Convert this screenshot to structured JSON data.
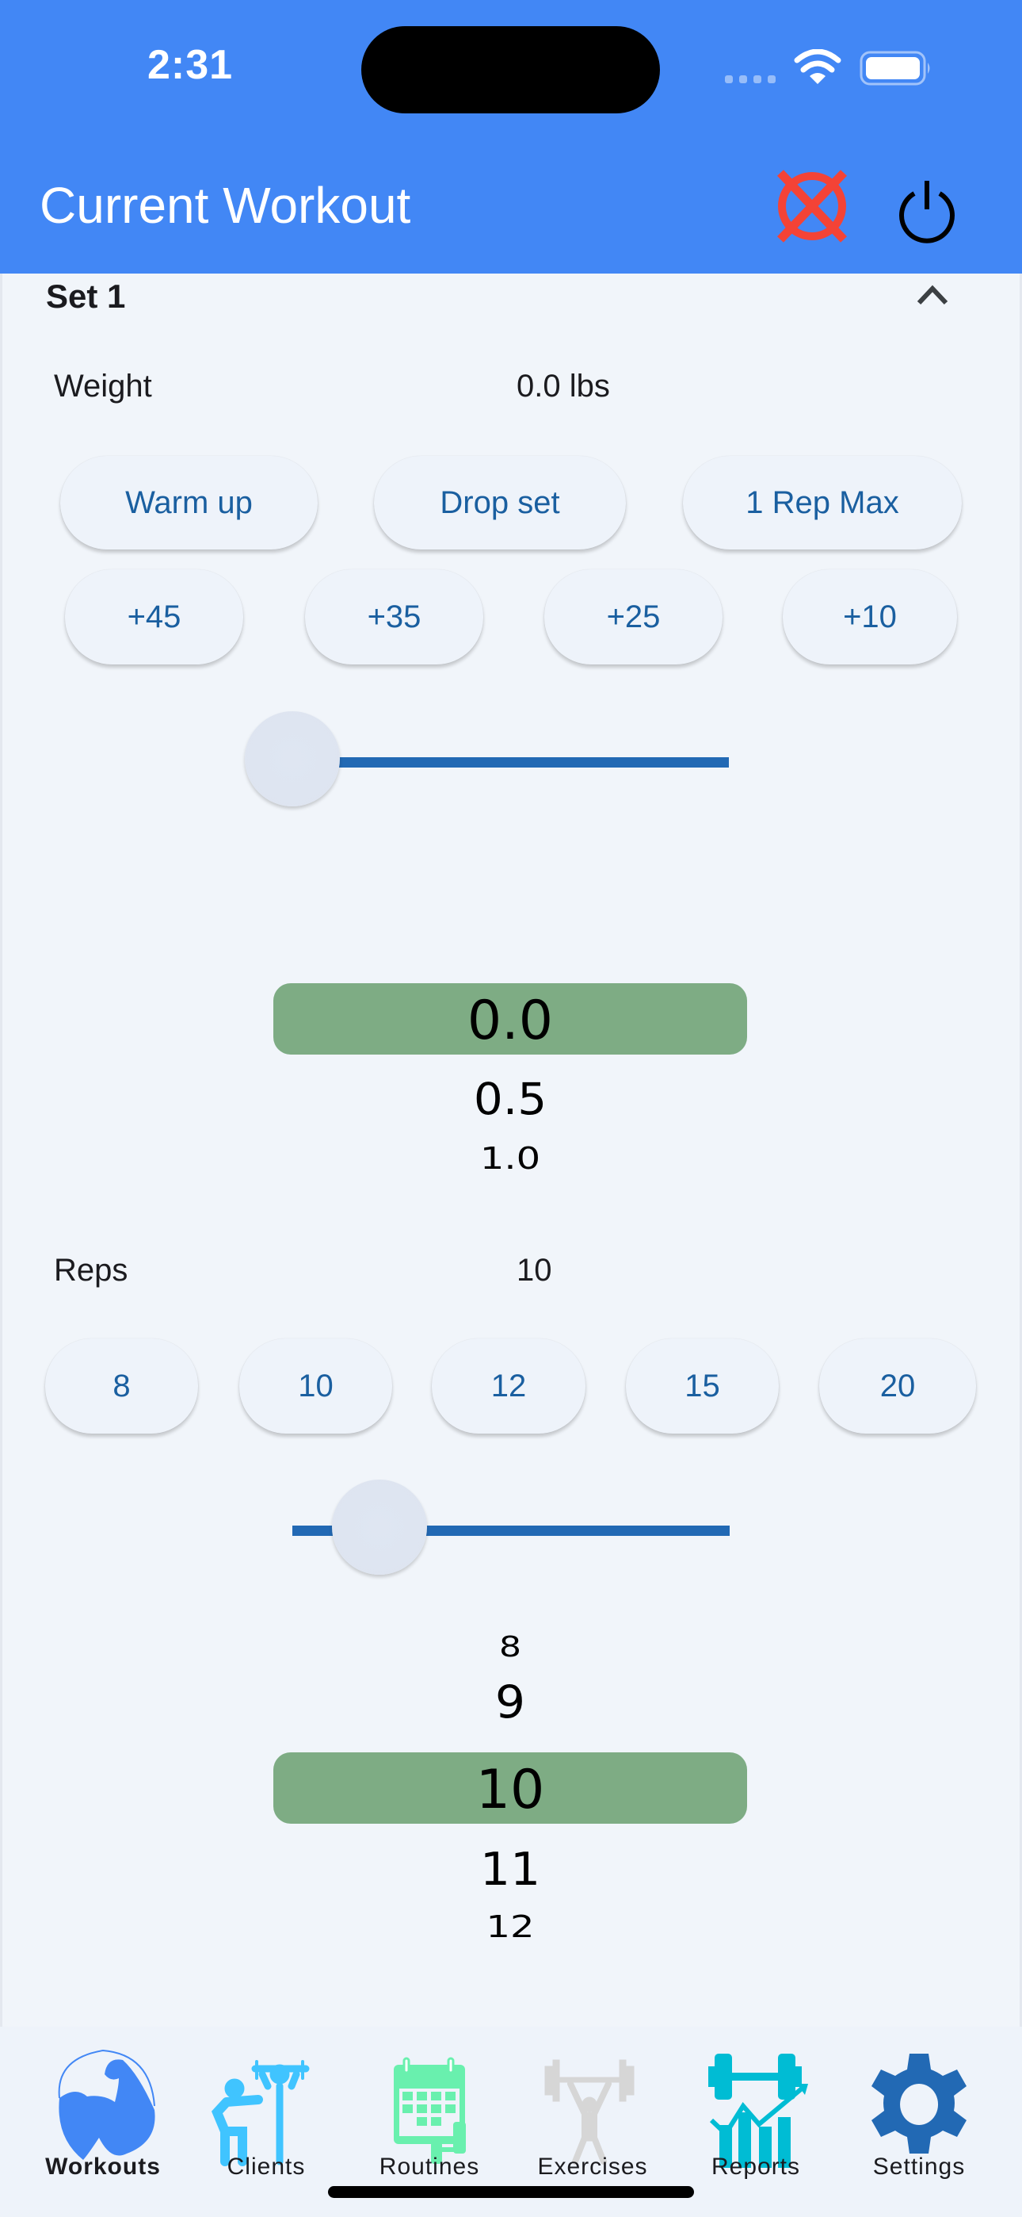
{
  "status_bar": {
    "time": "2:31"
  },
  "app_bar": {
    "title": "Current Workout",
    "actions": [
      {
        "name": "cancel-workout",
        "icon": "cancel-circle-x-icon",
        "color": "#F44336"
      },
      {
        "name": "power",
        "icon": "power-icon",
        "color": "#000000"
      }
    ]
  },
  "set": {
    "title": "Set 1",
    "expanded": true,
    "weight": {
      "label": "Weight",
      "value_display": "0.0 lbs",
      "set_type_buttons": [
        "Warm up",
        "Drop set",
        "1 Rep Max"
      ],
      "increment_buttons": [
        "+45",
        "+35",
        "+25",
        "+10"
      ],
      "slider_fraction": 0.0,
      "picker": {
        "selected": "0.0",
        "items_below": [
          "0.5",
          "1.0"
        ]
      }
    },
    "reps": {
      "label": "Reps",
      "value_display": "10",
      "quick_buttons": [
        "8",
        "10",
        "12",
        "15",
        "20"
      ],
      "slider_fraction": 0.2,
      "picker": {
        "items_above": [
          "8",
          "9"
        ],
        "selected": "10",
        "items_below": [
          "11",
          "12"
        ]
      }
    }
  },
  "colors": {
    "header": "#4287F5",
    "accent": "#2269B4",
    "button_text": "#1A5FA0",
    "picker_highlight": "#7EAC84",
    "background": "#F1F5FA"
  },
  "tabs": [
    {
      "label": "Workouts",
      "icon": "flexed-bicep-icon",
      "active": true,
      "color": "#4287F5"
    },
    {
      "label": "Clients",
      "icon": "trainer-client-icon",
      "active": false,
      "color": "#40C4FF"
    },
    {
      "label": "Routines",
      "icon": "calendar-dumbbell-icon",
      "active": false,
      "color": "#69F0AE"
    },
    {
      "label": "Exercises",
      "icon": "weightlifter-icon",
      "active": false,
      "color": "#D6D6D6"
    },
    {
      "label": "Reports",
      "icon": "dumbbell-chart-icon",
      "active": false,
      "color": "#00BCD4"
    },
    {
      "label": "Settings",
      "icon": "gear-icon",
      "active": false,
      "color": "#2269B4"
    }
  ]
}
